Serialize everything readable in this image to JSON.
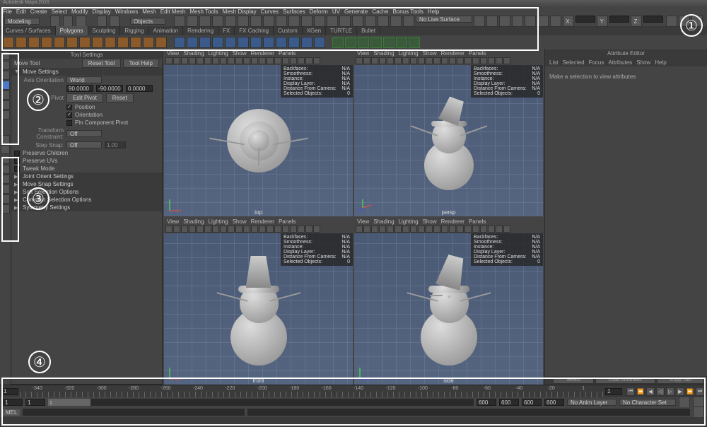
{
  "title": "Autodesk Maya 2016",
  "menubar": [
    "File",
    "Edit",
    "Create",
    "Select",
    "Modify",
    "Display",
    "Windows",
    "Mesh",
    "Edit Mesh",
    "Mesh Tools",
    "Mesh Display",
    "Curves",
    "Surfaces",
    "Deform",
    "UV",
    "Generate",
    "Cache",
    "Bonus Tools",
    "Help"
  ],
  "workspace_dropdown": "Modeling",
  "objects_dropdown": "Objects",
  "status_text": "No Live Surface",
  "shelf_tabs": [
    "Curves / Surfaces",
    "Polygons",
    "Sculpting",
    "Rigging",
    "Animation",
    "Rendering",
    "FX",
    "FX Caching",
    "Custom",
    "XGen",
    "TURTLE",
    "Bullet"
  ],
  "active_shelf_tab": 1,
  "tool_settings": {
    "panel_title": "Tool Settings",
    "tool_name": "Move Tool",
    "reset_btn": "Reset Tool",
    "help_btn": "Tool Help",
    "sections": {
      "move_settings": "Move Settings",
      "axis_orientation_lbl": "Axis Orientation",
      "axis_orientation_val": "World",
      "coords": [
        "90.0000",
        "-90.0000",
        "0.0000"
      ],
      "pivot_lbl": "Pivot",
      "edit_pivot": "Edit Pivot",
      "reset": "Reset",
      "position_chk": "Position",
      "orientation_chk": "Orientation",
      "pin_chk": "Pin Component Pivot",
      "transform_constraint_lbl": "Transform Constraint:",
      "transform_constraint_val": "Off",
      "step_snap_lbl": "Step Snap:",
      "step_snap_val": "Off",
      "step_snap_num": "1.00",
      "preserve_children": "Preserve Children",
      "preserve_uvs": "Preserve UVs",
      "tweak_mode": "Tweak Mode",
      "joint_orient": "Joint Orient Settings",
      "move_snap": "Move Snap Settings",
      "soft_selection": "Soft Selection Options",
      "common_selection": "Common Selection Options",
      "symmetry": "Symmetry Settings"
    }
  },
  "viewport_menu": [
    "View",
    "Shading",
    "Lighting",
    "Show",
    "Renderer",
    "Panels"
  ],
  "viewport_overlay_labels": [
    "Backfaces:",
    "Smoothness:",
    "Instance:",
    "Display Layer:",
    "Distance From Camera:",
    "Selected Objects:"
  ],
  "viewport_overlay_values": [
    "N/A",
    "N/A",
    "N/A",
    "N/A",
    "N/A",
    "0"
  ],
  "viewport_names": [
    "top",
    "persp",
    "front",
    "side"
  ],
  "attr_editor": {
    "title": "Attribute Editor",
    "tabs": [
      "List",
      "Selected",
      "Focus",
      "Attributes",
      "Show",
      "Help"
    ],
    "msg": "Make a selection to view attributes",
    "btns": [
      "Select",
      "Load Attributes",
      "Copy Tab"
    ]
  },
  "timeline": {
    "ticks": [
      "1",
      "-340",
      "-320",
      "-300",
      "-280",
      "-260",
      "-240",
      "-220",
      "-200",
      "-180",
      "-160",
      "-140",
      "-120",
      "-100",
      "-80",
      "-60",
      "-40",
      "-20",
      "1"
    ],
    "range_start": "1",
    "range_in": "1",
    "slider_cur": "1",
    "range_out": "600",
    "range_end": "600",
    "range_end2": "600",
    "cur_frame": "600",
    "anim_layer": "No Anim Layer",
    "char_set": "No Character Set"
  },
  "cmd_label": "MEL"
}
